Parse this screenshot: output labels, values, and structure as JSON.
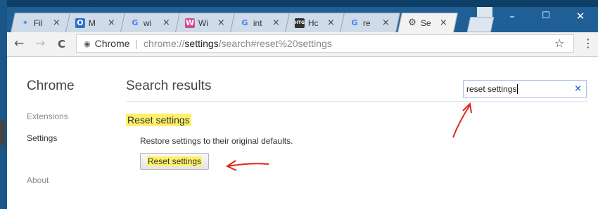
{
  "tabs": [
    {
      "title": "Fil",
      "icon": "dropbox-icon",
      "color": "#3d8ee8"
    },
    {
      "title": "M",
      "icon": "outlook-icon",
      "color": "#2b72c6"
    },
    {
      "title": "wi",
      "icon": "google-icon",
      "color": "#4285f4"
    },
    {
      "title": "Wi",
      "icon": "wiki-icon",
      "color": "#d14b8f"
    },
    {
      "title": "int",
      "icon": "google-icon",
      "color": "#4285f4"
    },
    {
      "title": "Hc",
      "icon": "htg-icon",
      "color": "#333333"
    },
    {
      "title": "re",
      "icon": "google-icon",
      "color": "#4285f4"
    },
    {
      "title": "Se",
      "icon": "gear-icon",
      "color": "#444444"
    }
  ],
  "favicon_text": {
    "dropbox": "✦",
    "outlook": "O",
    "google": "G",
    "wiki": "W",
    "htg": "HTG",
    "gear": "⚙"
  },
  "window_controls": {
    "minimize": "–",
    "maximize": "☐",
    "close": "✕"
  },
  "toolbar": {
    "back": "←",
    "forward": "→",
    "reload": "C",
    "site_chip": "Chrome",
    "url_scheme": "chrome://",
    "url_host": "settings",
    "url_path": "/search#reset%20settings",
    "star": "☆",
    "menu": "⋮"
  },
  "sidebar": {
    "title": "Chrome",
    "items": [
      {
        "label": "Extensions"
      },
      {
        "label": "Settings"
      },
      {
        "label": "About"
      }
    ]
  },
  "main": {
    "title": "Search results",
    "search_value": "reset settings",
    "clear": "×",
    "section_title": "Reset settings",
    "description": "Restore settings to their original defaults.",
    "button_label": "Reset settings"
  },
  "colors": {
    "highlight": "#fff069",
    "annotation": "#e0241b",
    "taskbar": "#0e3f66"
  }
}
